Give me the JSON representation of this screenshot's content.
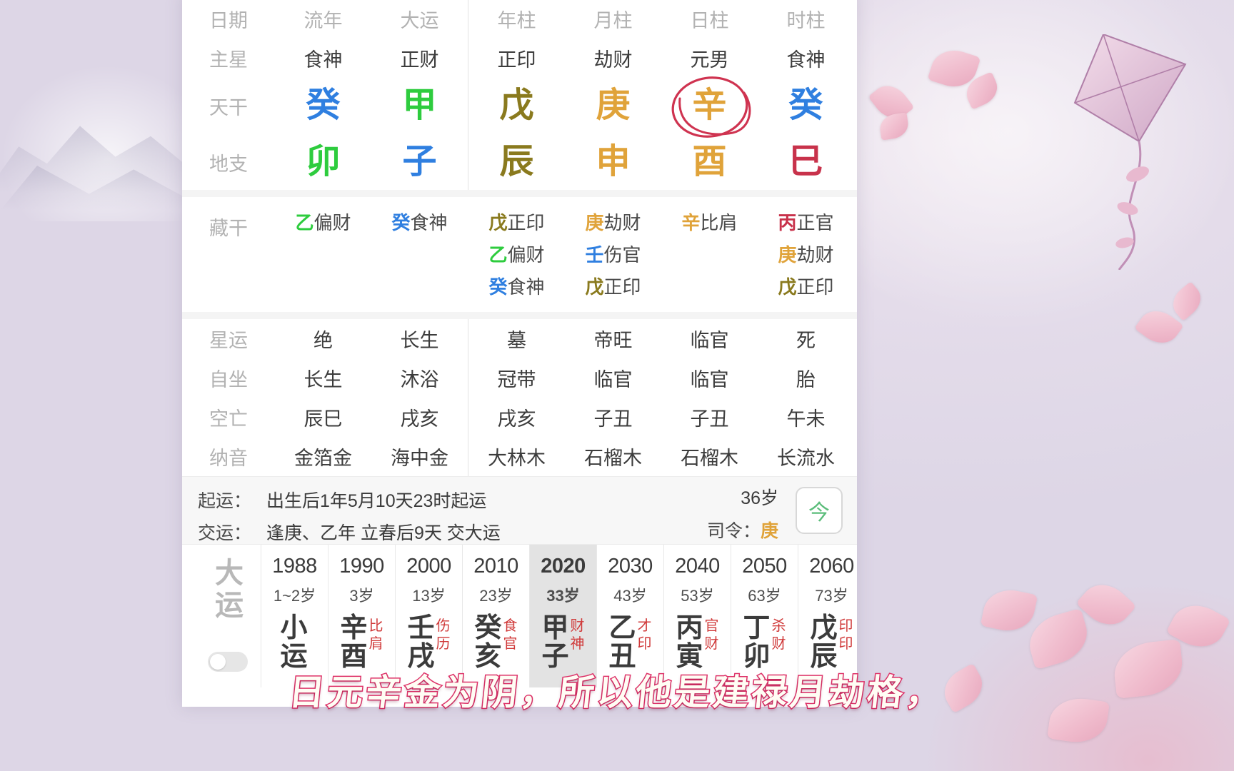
{
  "colors": {
    "wood_green": "#2ecc3e",
    "fire_red": "#c8324b",
    "earth_yellow": "#8a7a1e",
    "metal_gold": "#e0a33a",
    "water_blue": "#2f7fe0",
    "accent_gray": "#b2b2b2",
    "highlight": "#e3e3e3",
    "circle_red": "#cf3350",
    "subtitle_stroke": "#e0326a"
  },
  "chart": {
    "row_labels": {
      "date": "日期",
      "main_star": "主星",
      "heavenly_stem": "天干",
      "earthly_branch": "地支",
      "hidden_stems": "藏干",
      "star_fortune": "星运",
      "self_seat": "自坐",
      "void": "空亡",
      "nayin": "纳音"
    },
    "columns": [
      {
        "header": "流年",
        "main_star": "食神",
        "stem": {
          "char": "癸",
          "color": "#2f7fe0"
        },
        "branch": {
          "char": "卯",
          "color": "#2ecc3e"
        },
        "hidden": [
          {
            "stem": "乙",
            "color": "#2ecc3e",
            "god": "偏财"
          }
        ],
        "star_fortune": "绝",
        "self_seat": "长生",
        "void": "辰巳",
        "nayin": "金箔金"
      },
      {
        "header": "大运",
        "main_star": "正财",
        "stem": {
          "char": "甲",
          "color": "#2ecc3e"
        },
        "branch": {
          "char": "子",
          "color": "#2f7fe0"
        },
        "hidden": [
          {
            "stem": "癸",
            "color": "#2f7fe0",
            "god": "食神"
          }
        ],
        "star_fortune": "长生",
        "self_seat": "沐浴",
        "void": "戌亥",
        "nayin": "海中金"
      },
      {
        "header": "年柱",
        "main_star": "正印",
        "stem": {
          "char": "戊",
          "color": "#8a7a1e"
        },
        "branch": {
          "char": "辰",
          "color": "#8a7a1e"
        },
        "hidden": [
          {
            "stem": "戊",
            "color": "#8a7a1e",
            "god": "正印"
          },
          {
            "stem": "乙",
            "color": "#2ecc3e",
            "god": "偏财"
          },
          {
            "stem": "癸",
            "color": "#2f7fe0",
            "god": "食神"
          }
        ],
        "star_fortune": "墓",
        "self_seat": "冠带",
        "void": "戌亥",
        "nayin": "大林木"
      },
      {
        "header": "月柱",
        "main_star": "劫财",
        "stem": {
          "char": "庚",
          "color": "#e0a33a"
        },
        "branch": {
          "char": "申",
          "color": "#e0a33a"
        },
        "hidden": [
          {
            "stem": "庚",
            "color": "#e0a33a",
            "god": "劫财"
          },
          {
            "stem": "壬",
            "color": "#2f7fe0",
            "god": "伤官"
          },
          {
            "stem": "戊",
            "color": "#8a7a1e",
            "god": "正印"
          }
        ],
        "star_fortune": "帝旺",
        "self_seat": "临官",
        "void": "子丑",
        "nayin": "石榴木"
      },
      {
        "header": "日柱",
        "main_star": "元男",
        "stem": {
          "char": "辛",
          "color": "#e0a33a",
          "circled": true
        },
        "branch": {
          "char": "酉",
          "color": "#e0a33a"
        },
        "hidden": [
          {
            "stem": "辛",
            "color": "#e0a33a",
            "god": "比肩"
          }
        ],
        "star_fortune": "临官",
        "self_seat": "临官",
        "void": "子丑",
        "nayin": "石榴木"
      },
      {
        "header": "时柱",
        "main_star": "食神",
        "stem": {
          "char": "癸",
          "color": "#2f7fe0"
        },
        "branch": {
          "char": "巳",
          "color": "#c8324b"
        },
        "hidden": [
          {
            "stem": "丙",
            "color": "#c8324b",
            "god": "正官"
          },
          {
            "stem": "庚",
            "color": "#e0a33a",
            "god": "劫财"
          },
          {
            "stem": "戊",
            "color": "#8a7a1e",
            "god": "正印"
          }
        ],
        "star_fortune": "死",
        "self_seat": "胎",
        "void": "午未",
        "nayin": "长流水"
      }
    ]
  },
  "fortune_info": {
    "start_key": "起运：",
    "start_value": "出生后1年5月10天23时起运",
    "switch_key": "交运：",
    "switch_value": "逢庚、乙年 立春后9天 交大运",
    "age_display": "36岁",
    "siling_key": "司令：",
    "siling_value": "庚",
    "today_button_label": "今"
  },
  "dayun": {
    "label": "大运",
    "items": [
      {
        "year": "1988",
        "age": "1~2岁",
        "stem": "小",
        "branch": "运",
        "stem_color": "#3b3b3b",
        "branch_color": "#3b3b3b",
        "stem_god": "",
        "branch_god": "",
        "active": false
      },
      {
        "year": "1990",
        "age": "3岁",
        "stem": "辛",
        "branch": "酉",
        "stem_color": "#3b3b3b",
        "branch_color": "#3b3b3b",
        "stem_god": "比",
        "branch_god": "肩",
        "active": false
      },
      {
        "year": "2000",
        "age": "13岁",
        "stem": "壬",
        "branch": "戌",
        "stem_color": "#3b3b3b",
        "branch_color": "#3b3b3b",
        "stem_god": "伤",
        "branch_god": "历",
        "active": false
      },
      {
        "year": "2010",
        "age": "23岁",
        "stem": "癸",
        "branch": "亥",
        "stem_color": "#3b3b3b",
        "branch_color": "#3b3b3b",
        "stem_god": "食",
        "branch_god": "官",
        "active": false
      },
      {
        "year": "2020",
        "age": "33岁",
        "stem": "甲",
        "branch": "子",
        "stem_color": "#3b3b3b",
        "branch_color": "#3b3b3b",
        "stem_god": "财",
        "branch_god": "神",
        "active": true
      },
      {
        "year": "2030",
        "age": "43岁",
        "stem": "乙",
        "branch": "丑",
        "stem_color": "#3b3b3b",
        "branch_color": "#3b3b3b",
        "stem_god": "才",
        "branch_god": "印",
        "active": false
      },
      {
        "year": "2040",
        "age": "53岁",
        "stem": "丙",
        "branch": "寅",
        "stem_color": "#3b3b3b",
        "branch_color": "#3b3b3b",
        "stem_god": "官",
        "branch_god": "财",
        "active": false
      },
      {
        "year": "2050",
        "age": "63岁",
        "stem": "丁",
        "branch": "卯",
        "stem_color": "#3b3b3b",
        "branch_color": "#3b3b3b",
        "stem_god": "杀",
        "branch_god": "财",
        "active": false
      },
      {
        "year": "2060",
        "age": "73岁",
        "stem": "戊",
        "branch": "辰",
        "stem_color": "#3b3b3b",
        "branch_color": "#3b3b3b",
        "stem_god": "印",
        "branch_god": "印",
        "active": false
      }
    ]
  },
  "subtitle": {
    "text": "日元辛金为阴，所以他是建禄月劫格，"
  }
}
